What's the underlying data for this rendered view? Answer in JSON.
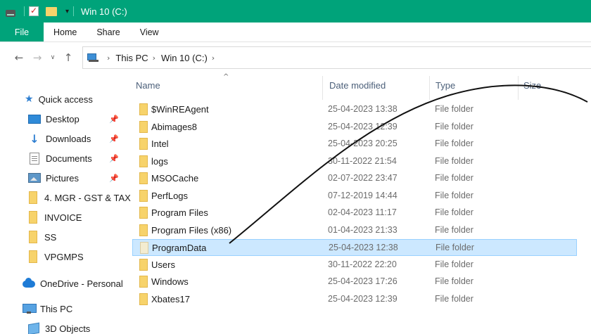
{
  "window": {
    "title": "Win 10 (C:)"
  },
  "ribbon": {
    "tabs": [
      "File",
      "Home",
      "Share",
      "View"
    ]
  },
  "address": {
    "crumbs": [
      "This PC",
      "Win 10 (C:)"
    ]
  },
  "sidebar": {
    "quick_access": "Quick access",
    "items": [
      {
        "label": "Desktop",
        "icon": "desktop-icon",
        "pinned": true
      },
      {
        "label": "Downloads",
        "icon": "downloads-icon",
        "pinned": true
      },
      {
        "label": "Documents",
        "icon": "documents-icon",
        "pinned": true
      },
      {
        "label": "Pictures",
        "icon": "pictures-icon",
        "pinned": true
      },
      {
        "label": "4. MGR - GST & TAX",
        "icon": "folder-icon",
        "pinned": false
      },
      {
        "label": "INVOICE",
        "icon": "folder-icon",
        "pinned": false
      },
      {
        "label": "SS",
        "icon": "folder-icon",
        "pinned": false
      },
      {
        "label": "VPGMPS",
        "icon": "folder-icon",
        "pinned": false
      }
    ],
    "onedrive": "OneDrive - Personal",
    "this_pc": "This PC",
    "objects_3d": "3D Objects"
  },
  "list": {
    "columns": {
      "name": "Name",
      "date": "Date modified",
      "type": "Type",
      "size": "Size"
    },
    "rows": [
      {
        "name": "$WinREAgent",
        "date": "25-04-2023 13:38",
        "type": "File folder"
      },
      {
        "name": "Abimages8",
        "date": "25-04-2023 12:39",
        "type": "File folder"
      },
      {
        "name": "Intel",
        "date": "25-04-2023 20:25",
        "type": "File folder"
      },
      {
        "name": "logs",
        "date": "30-11-2022 21:54",
        "type": "File folder"
      },
      {
        "name": "MSOCache",
        "date": "02-07-2022 23:47",
        "type": "File folder"
      },
      {
        "name": "PerfLogs",
        "date": "07-12-2019 14:44",
        "type": "File folder"
      },
      {
        "name": "Program Files",
        "date": "02-04-2023 11:17",
        "type": "File folder"
      },
      {
        "name": "Program Files (x86)",
        "date": "01-04-2023 21:33",
        "type": "File folder"
      },
      {
        "name": "ProgramData",
        "date": "25-04-2023 12:38",
        "type": "File folder",
        "selected": true
      },
      {
        "name": "Users",
        "date": "30-11-2022 22:20",
        "type": "File folder"
      },
      {
        "name": "Windows",
        "date": "25-04-2023 17:26",
        "type": "File folder"
      },
      {
        "name": "Xbates17",
        "date": "25-04-2023 12:39",
        "type": "File folder"
      }
    ]
  },
  "colors": {
    "accent": "#00a37a",
    "selection": "#cce8ff",
    "folder": "#f7d36b"
  }
}
